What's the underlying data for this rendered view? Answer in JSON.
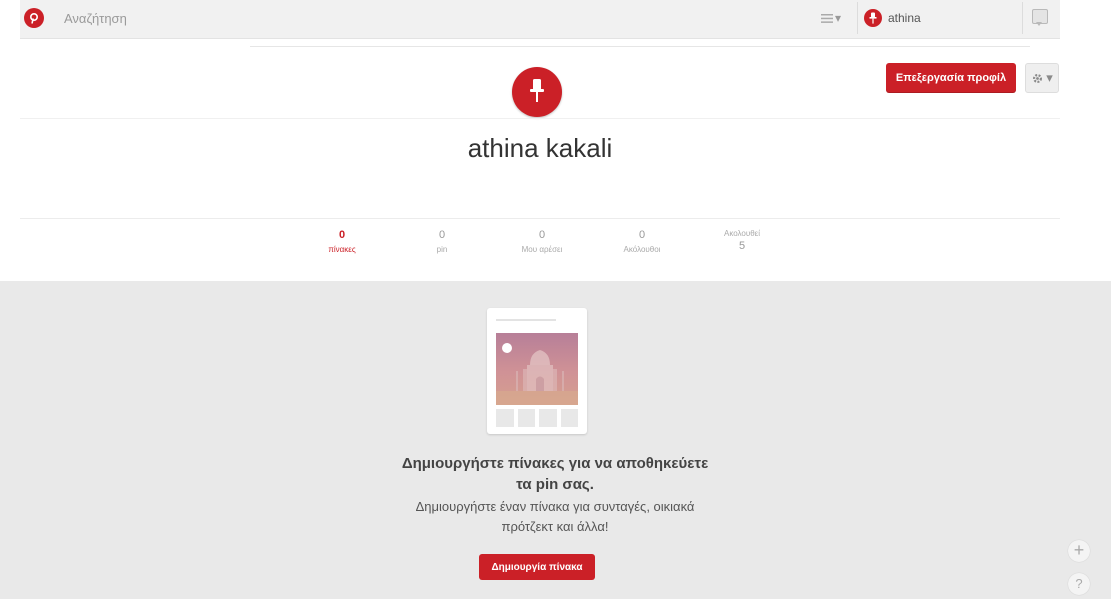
{
  "topbar": {
    "logo_icon": "pinterest-logo-icon",
    "search_placeholder": "Αναζήτηση",
    "menu_icon": "hamburger-menu-icon",
    "menu_caret": "▾",
    "user_name": "athina",
    "notifications_icon": "speech-bubble-icon"
  },
  "profile": {
    "name": "athina kakali",
    "avatar_icon": "pushpin-icon",
    "edit_profile_label": "Επεξεργασία προφίλ",
    "settings_icon": "gear-icon",
    "settings_caret": "▾"
  },
  "stats": [
    {
      "count": "0",
      "label": "πίνακες",
      "active": true
    },
    {
      "count": "0",
      "label": "pin",
      "active": false
    },
    {
      "count": "0",
      "label": "Μου αρέσει",
      "active": false
    },
    {
      "count": "0",
      "label": "Ακόλουθοι",
      "active": false
    },
    {
      "count": "5",
      "label": "Ακολουθεί",
      "active": false
    }
  ],
  "empty_state": {
    "title_line1": "Δημιουργήστε πίνακες για να αποθηκεύετε",
    "title_line2": "τα pin σας.",
    "desc_line1": "Δημιουργήστε έναν πίνακα για συνταγές, οικιακά",
    "desc_line2": "πρότζεκτ και άλλα!",
    "create_board_label": "Δημιουργία πίνακα"
  },
  "side_buttons": {
    "plus": "+",
    "help": "?"
  },
  "colors": {
    "brand": "#cb2027",
    "empty_bg": "#e9e9e9"
  }
}
